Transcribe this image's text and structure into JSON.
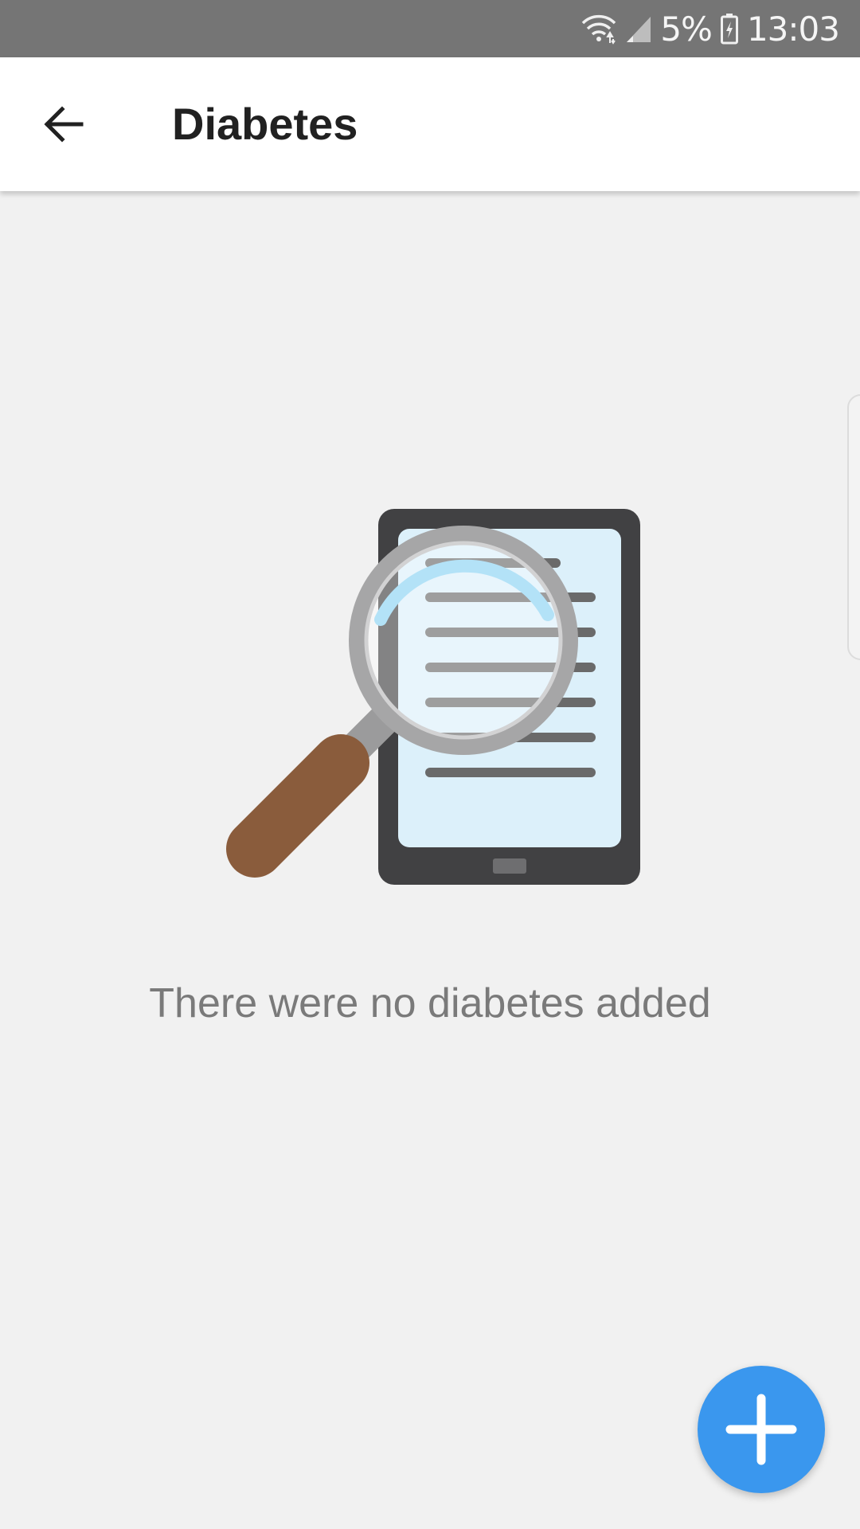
{
  "status_bar": {
    "battery": "5%",
    "time": "13:03",
    "icons": [
      "wifi-icon",
      "signal-icon",
      "battery-icon"
    ]
  },
  "app_bar": {
    "back_icon": "arrow-back-icon",
    "title": "Diabetes"
  },
  "empty_state": {
    "illustration": "tablet-magnifier-illustration",
    "message": "There were no diabetes added"
  },
  "fab": {
    "icon": "plus-icon",
    "color": "#3a97ee"
  },
  "colors": {
    "status_bar": "#757575",
    "app_bar": "#ffffff",
    "background": "#f1f1f1",
    "title": "#212121",
    "message": "#7a7a7a",
    "accent": "#3a97ee"
  }
}
